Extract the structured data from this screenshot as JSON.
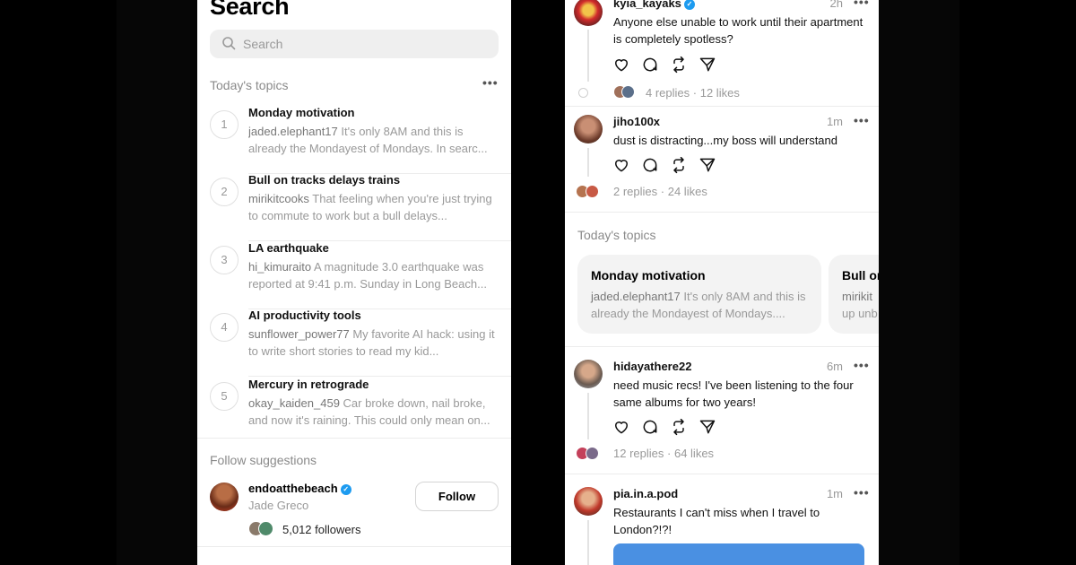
{
  "left": {
    "title": "Search",
    "search_placeholder": "Search",
    "todays_topics_label": "Today's topics",
    "topics": [
      {
        "rank": "1",
        "title": "Monday motivation",
        "user": "jaded.elephant17",
        "snippet": " It's only 8AM and this is already the Mondayest of Mondays. In searc..."
      },
      {
        "rank": "2",
        "title": "Bull on tracks delays trains",
        "user": "mirikitcooks",
        "snippet": " That feeling when you're just trying to commute to work but a bull delays..."
      },
      {
        "rank": "3",
        "title": "LA earthquake",
        "user": "hi_kimuraito",
        "snippet": " A magnitude 3.0 earthquake was reported at 9:41 p.m. Sunday in Long Beach..."
      },
      {
        "rank": "4",
        "title": "AI productivity tools",
        "user": "sunflower_power77",
        "snippet": " My favorite AI hack: using it to write short stories to read my kid..."
      },
      {
        "rank": "5",
        "title": "Mercury in retrograde",
        "user": "okay_kaiden_459",
        "snippet": " Car broke down, nail broke, and now it's raining. This could only mean on..."
      }
    ],
    "follow_label": "Follow suggestions",
    "suggestion": {
      "username": "endoatthebeach",
      "name": "Jade Greco",
      "followers": "5,012 followers",
      "button": "Follow"
    }
  },
  "right": {
    "posts": [
      {
        "user": "kyia_kayaks",
        "time": "2h",
        "text": "Anyone else unable to work until their apartment is completely spotless?",
        "replies": "4 replies",
        "likes": "12 likes"
      },
      {
        "user": "jiho100x",
        "time": "1m",
        "text": "dust is distracting...my boss will understand",
        "replies": "2 replies",
        "likes": "24 likes"
      },
      {
        "user": "hidayathere22",
        "time": "6m",
        "text": "need music recs! I've been listening to the four same albums for two years!",
        "replies": "12 replies",
        "likes": "64 likes"
      },
      {
        "user": "pia.in.a.pod",
        "time": "1m",
        "text": "Restaurants I can't miss when I travel to London?!?!"
      }
    ],
    "todays_topics_label": "Today's topics",
    "cards": [
      {
        "title": "Monday motivation",
        "user": "jaded.elephant17",
        "snippet": " It's only 8AM and this is already the Mondayest of Mondays...."
      },
      {
        "title": "Bull on",
        "user": "mirikit",
        "snippet": " up unb"
      }
    ],
    "separator": "·"
  },
  "icons": {
    "search": "search-icon",
    "more": "more-icon",
    "verified": "verified-icon",
    "like": "heart-icon",
    "comment": "comment-icon",
    "repost": "repost-icon",
    "share": "send-icon"
  },
  "colors": {
    "verified": "#1d9bf0",
    "muted": "#999999",
    "accent_bar": "#4a90e2"
  }
}
